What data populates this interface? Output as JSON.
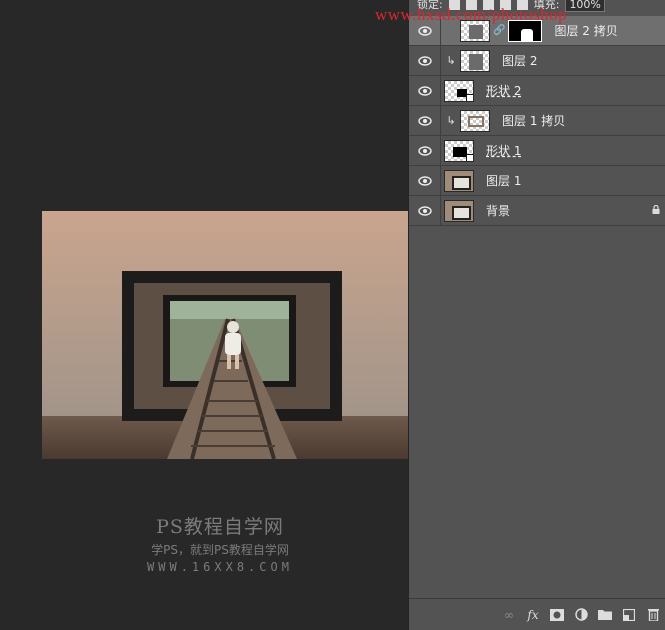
{
  "watermark_url": "www.hxsd.com/photoshop",
  "lock_bar": {
    "lock_label": "锁定:",
    "fill_label": "填充:",
    "fill_value": "100%"
  },
  "layers": [
    {
      "name": "图层 2 拷贝",
      "visible": true,
      "selected": true,
      "clipped": false,
      "has_mask": true,
      "thumb": "photo-checker"
    },
    {
      "name": "图层 2",
      "visible": true,
      "selected": false,
      "clipped": true,
      "has_mask": false,
      "thumb": "photo-checker"
    },
    {
      "name": "形状 2",
      "visible": true,
      "selected": false,
      "clipped": false,
      "has_mask": false,
      "thumb": "shape"
    },
    {
      "name": "图层 1 拷贝",
      "visible": true,
      "selected": false,
      "clipped": true,
      "has_mask": false,
      "thumb": "checker-frame"
    },
    {
      "name": "形状 1",
      "visible": true,
      "selected": false,
      "clipped": false,
      "has_mask": false,
      "thumb": "shape"
    },
    {
      "name": "图层 1",
      "visible": true,
      "selected": false,
      "clipped": false,
      "has_mask": false,
      "thumb": "photo"
    },
    {
      "name": "背景",
      "visible": true,
      "selected": false,
      "clipped": false,
      "has_mask": false,
      "thumb": "photo",
      "locked": true
    }
  ],
  "footer_icons": [
    "link-icon",
    "fx-icon",
    "add-mask-icon",
    "adjustment-layer-icon",
    "new-group-icon",
    "new-layer-icon",
    "trash-icon"
  ],
  "footer_labels": {
    "fx": "fx"
  },
  "site_watermark": {
    "title": "PS教程自学网",
    "subtitle": "学PS，就到PS教程自学网",
    "url": "WWW.16XX8.COM"
  }
}
